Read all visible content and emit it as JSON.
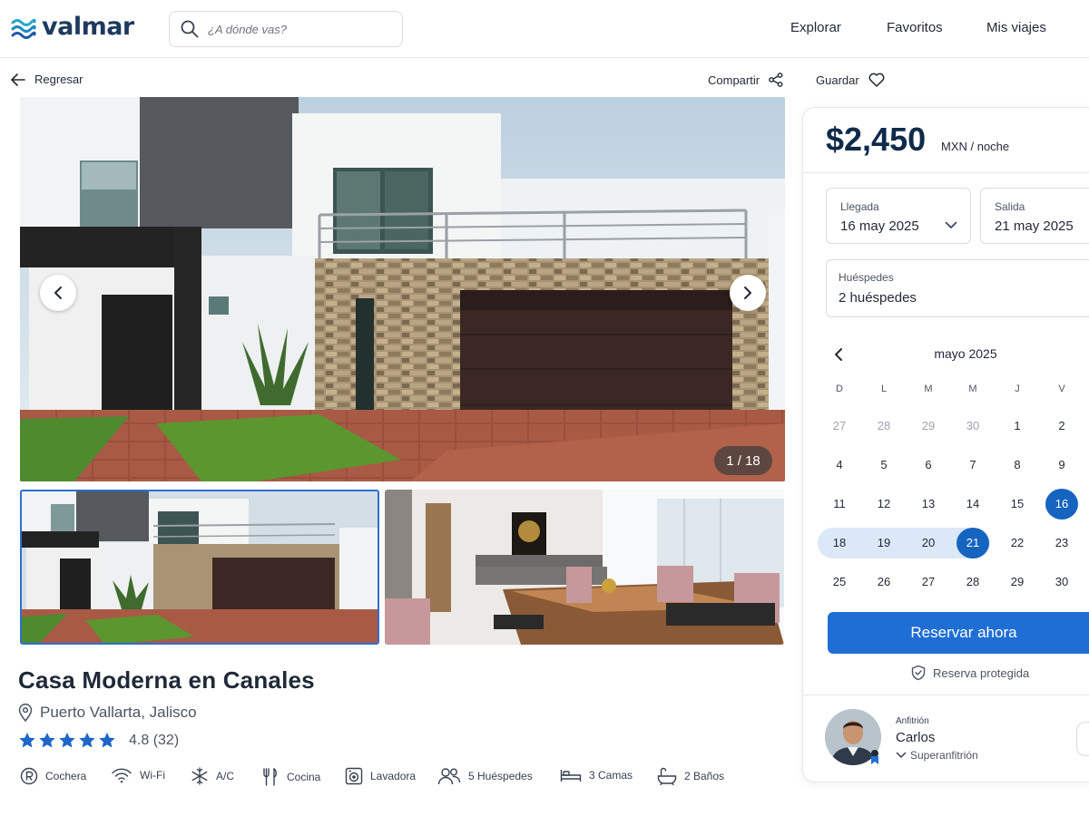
{
  "header": {
    "logo": "valmar",
    "search_placeholder": "¿A dónde vas?",
    "nav": [
      "Explorar",
      "Favoritos",
      "Mis viajes"
    ]
  },
  "subbar": {
    "back": "Regresar",
    "share": "Compartir",
    "save": "Guardar"
  },
  "gallery": {
    "counter": "1 / 18"
  },
  "listing": {
    "title": "Casa Moderna en Canales",
    "location": "Puerto Vallarta, Jalisco",
    "rating": "4.8 (32)",
    "stars": 5,
    "amenities": [
      {
        "icon": "parking-icon",
        "label": "Cochera"
      },
      {
        "icon": "wifi-icon",
        "label": "Wi-Fi"
      },
      {
        "icon": "snowflake-icon",
        "label": "A/C"
      },
      {
        "icon": "utensils-icon",
        "label": "Cocina"
      },
      {
        "icon": "washer-icon",
        "label": "Lavadora"
      },
      {
        "icon": "guests-icon",
        "label": "5 Huéspedes"
      },
      {
        "icon": "bed-icon",
        "label": "3 Camas"
      },
      {
        "icon": "bath-icon",
        "label": "2 Baños"
      }
    ]
  },
  "booking": {
    "price": "$2,450",
    "price_unit": "MXN / noche",
    "checkin_label": "Llegada",
    "checkin_value": "16 may 2025",
    "checkout_label": "Salida",
    "checkout_value": "21 may 2025",
    "guests_label": "Huéspedes",
    "guests_value": "2 huéspedes",
    "calendar": {
      "month": "mayo 2025",
      "weekdays": [
        "D",
        "L",
        "M",
        "M",
        "J",
        "V"
      ],
      "weeks": [
        [
          "27",
          "28",
          "29",
          "30",
          "1",
          "2"
        ],
        [
          "4",
          "5",
          "6",
          "7",
          "8",
          "9"
        ],
        [
          "11",
          "12",
          "13",
          "14",
          "15",
          "16"
        ],
        [
          "18",
          "19",
          "20",
          "21",
          "22",
          "23"
        ],
        [
          "25",
          "26",
          "27",
          "28",
          "29",
          "30"
        ]
      ],
      "selected_start": "16",
      "selected_end": "21"
    },
    "book_button": "Reservar ahora",
    "protected": "Reserva protegida"
  },
  "host": {
    "label": "Anfitrión",
    "name": "Carlos",
    "badge": "Superanfitrión"
  },
  "colors": {
    "accent": "#1f6ed4",
    "logo": "#1e3a5f",
    "selected_day": "#1565c0",
    "range": "#dbe8f7"
  }
}
